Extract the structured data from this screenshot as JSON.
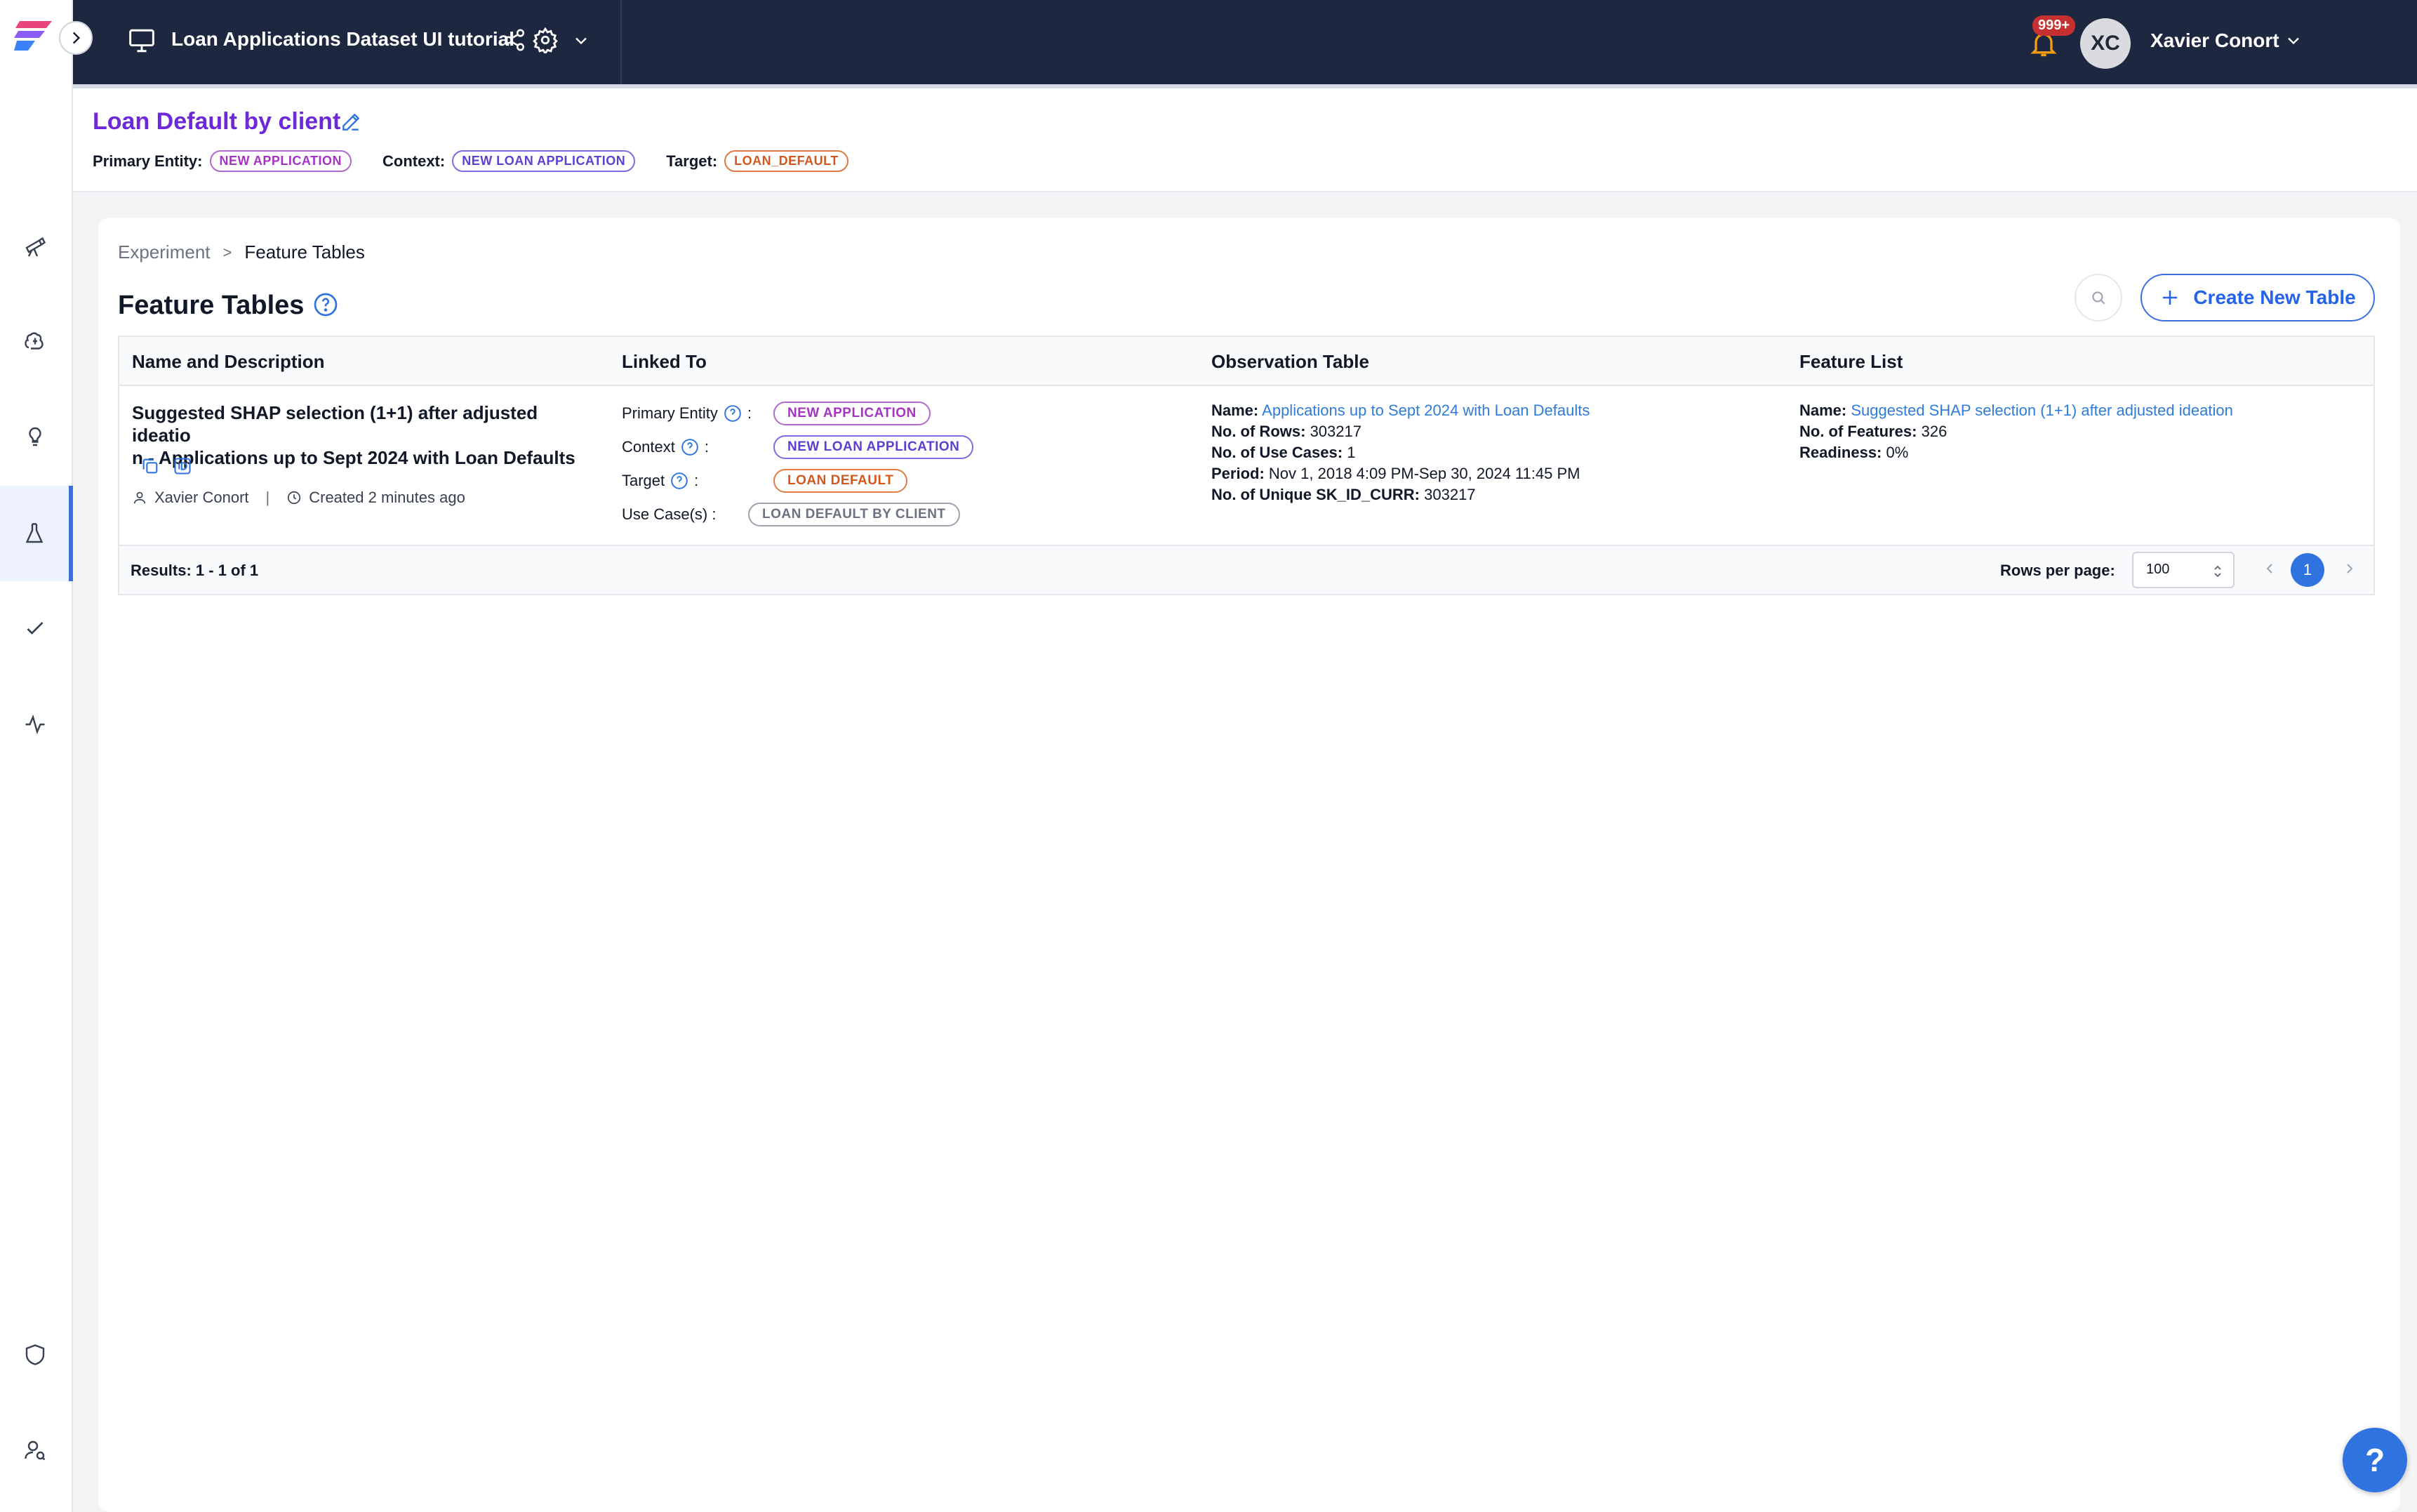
{
  "topbar": {
    "project_title": "Loan Applications Dataset UI tutorial",
    "notifications_badge": "999+",
    "user_initials": "XC",
    "user_name": "Xavier Conort"
  },
  "use_case": {
    "title": "Loan Default by client",
    "primary_entity_label": "Primary Entity:",
    "primary_entity": "NEW APPLICATION",
    "context_label": "Context:",
    "context": "NEW LOAN APPLICATION",
    "target_label": "Target:",
    "target": "LOAN_DEFAULT"
  },
  "breadcrumb": {
    "parent": "Experiment",
    "separator": ">",
    "current": "Feature Tables"
  },
  "page": {
    "title": "Feature Tables",
    "create_button": "Create New Table"
  },
  "table": {
    "headers": [
      "Name and Description",
      "Linked To",
      "Observation Table",
      "Feature List"
    ],
    "rows": [
      {
        "name_line1": "Suggested SHAP selection (1+1) after adjusted ideatio",
        "name_line2": "n - Applications up to Sept 2024 with Loan Defaults",
        "owner": "Xavier Conort",
        "separator": "|",
        "created": "Created 2 minutes ago",
        "linked": {
          "primary_entity_label": "Primary Entity",
          "primary_entity": "NEW APPLICATION",
          "context_label": "Context",
          "context": "NEW LOAN APPLICATION",
          "target_label": "Target",
          "target": "LOAN DEFAULT",
          "use_cases_label": "Use Case(s) :",
          "use_case": "LOAN DEFAULT BY CLIENT",
          "colon": ":"
        },
        "observation": {
          "name_label": "Name:",
          "name": "Applications up to Sept 2024 with Loan Defaults",
          "rows_label": "No. of Rows:",
          "rows": "303217",
          "use_cases_label": "No. of Use Cases:",
          "use_cases": "1",
          "period_label": "Period:",
          "period": "Nov 1, 2018 4:09 PM-Sep 30, 2024 11:45 PM",
          "unique_label": "No. of Unique SK_ID_CURR:",
          "unique": "303217"
        },
        "feature_list": {
          "name_label": "Name:",
          "name": "Suggested SHAP selection (1+1) after adjusted ideation",
          "features_label": "No. of Features:",
          "features": "326",
          "readiness_label": "Readiness:",
          "readiness": "0%"
        }
      }
    ],
    "footer": {
      "results": "Results: 1 - 1 of 1",
      "rows_per_page_label": "Rows per page:",
      "rows_per_page": "100",
      "current_page": "1"
    }
  },
  "help_fab": "?",
  "colors": {
    "topbar_bg": "#1e2740",
    "accent_blue": "#2f73e0",
    "title_purple": "#6d28d9",
    "link_blue": "#2f7bd8"
  },
  "icons": {
    "sidebar": [
      "telescope-icon",
      "brain-icon",
      "lightbulb-icon",
      "flask-icon",
      "check-icon",
      "activity-icon",
      "shield-icon",
      "user-search-icon"
    ]
  }
}
